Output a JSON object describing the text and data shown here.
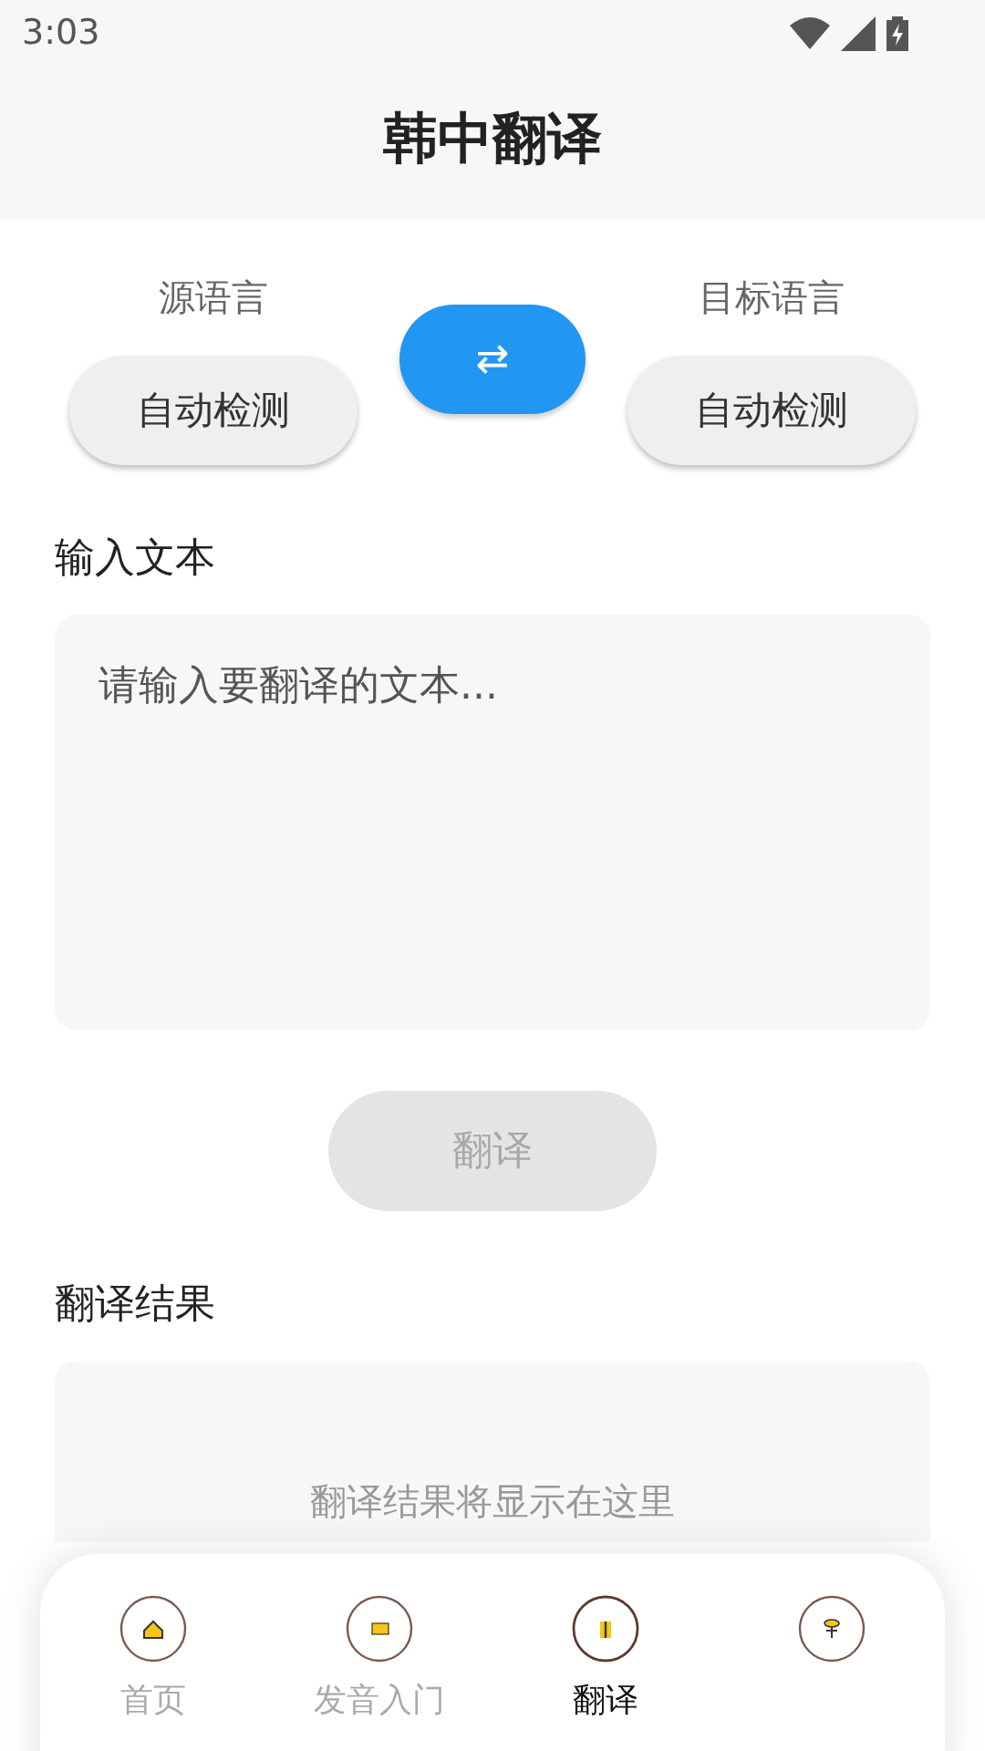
{
  "status_bar": {
    "time": "3:03"
  },
  "header": {
    "title": "韩中翻译"
  },
  "languages": {
    "source_label": "源语言",
    "source": "自动检测",
    "swap": "⇄",
    "target_label": "目标语言",
    "target": "自动检测"
  },
  "input": {
    "label": "输入文本",
    "placeholder": "请输入要翻译的文本..."
  },
  "translate_button": {
    "label": "翻译",
    "disabled": true
  },
  "result": {
    "label": "翻译结果",
    "placeholder": "翻译结果将显示在这里"
  },
  "nav": [
    {
      "label": "首页",
      "selected": false
    },
    {
      "label": "发音入门",
      "selected": false
    },
    {
      "label": "翻译",
      "selected": true
    },
    {
      "selected": false
    }
  ]
}
